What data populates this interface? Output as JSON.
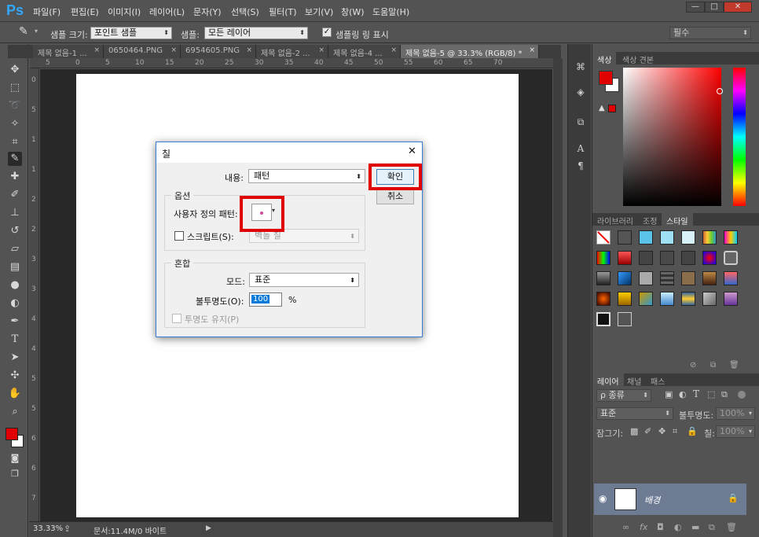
{
  "app": {
    "logo": "Ps"
  },
  "menu": [
    "파일(F)",
    "편집(E)",
    "이미지(I)",
    "레이어(L)",
    "문자(Y)",
    "선택(S)",
    "필터(T)",
    "보기(V)",
    "창(W)",
    "도움말(H)"
  ],
  "window_controls": {
    "minimize": "—",
    "maximize": "□",
    "close": "✕"
  },
  "options": {
    "sample_size_label": "샘플 크기:",
    "sample_size_value": "포인트 샘플",
    "sample_label": "샘플:",
    "sample_value": "모든 레이어",
    "show_ring_label": "샘플링 링 표시",
    "workspace_value": "필수"
  },
  "tabs": [
    {
      "label": "제목 없음-1 ...",
      "active": false
    },
    {
      "label": "0650464.PNG",
      "active": false
    },
    {
      "label": "6954605.PNG",
      "active": false
    },
    {
      "label": "제목 없음-2 ...",
      "active": false
    },
    {
      "label": "제목 없음-4 ...",
      "active": false
    },
    {
      "label": "제목 없음-5 @ 33.3% (RGB/8) *",
      "active": true
    }
  ],
  "ruler": {
    "top_ticks": [
      "5",
      "0",
      "5",
      "10",
      "15",
      "20",
      "25",
      "30",
      "35",
      "40",
      "45",
      "50",
      "55",
      "60",
      "65",
      "70"
    ],
    "left_ticks": [
      "0",
      "5",
      "1",
      "1",
      "2",
      "2",
      "3",
      "3",
      "4",
      "4",
      "5",
      "5",
      "6",
      "6",
      "7"
    ]
  },
  "status": {
    "zoom": "33.33%",
    "doc_size": "문서:11.4M/0 바이트"
  },
  "color_panel": {
    "tabs": [
      "색상",
      "색상 견본"
    ],
    "fg_color": "#e00000",
    "bg_color": "#ffffff"
  },
  "styles_panel": {
    "tabs": [
      "라이브러리",
      "조정",
      "스타일"
    ]
  },
  "layers_panel": {
    "tabs": [
      "레이어",
      "채널",
      "패스"
    ],
    "filter_label": "ρ 종류",
    "blend_mode": "표준",
    "opacity_label": "불투명도:",
    "opacity_value": "100%",
    "lock_label": "잠그기:",
    "fill_label": "칠:",
    "fill_value": "100%",
    "layer_name": "배경"
  },
  "dialog": {
    "title": "칠",
    "close_label": "✕",
    "contents_label": "내용:",
    "contents_value": "패턴",
    "ok_label": "확인",
    "cancel_label": "취소",
    "options_group": "옵션",
    "custom_pattern_label": "사용자 정의 패턴:",
    "script_label": "스크립트(S):",
    "script_value": "벽돌 칠",
    "blend_group": "혼합",
    "mode_label": "모드:",
    "mode_value": "표준",
    "opacity_label": "불투명도(O):",
    "opacity_value": "100",
    "opacity_unit": "%",
    "preserve_label": "투명도 유지(P)"
  }
}
